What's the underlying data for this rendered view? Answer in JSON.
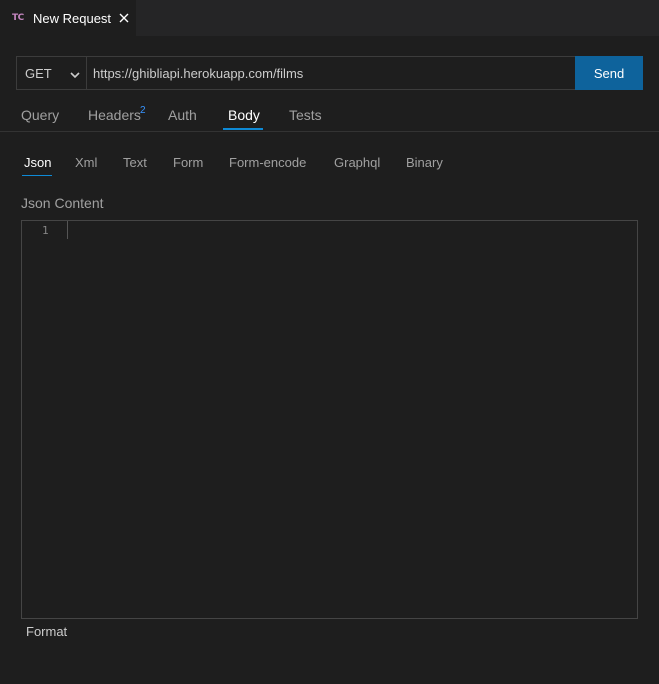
{
  "tab": {
    "logo": "TC",
    "title": "New Request"
  },
  "request": {
    "method": "GET",
    "url": "https://ghibliapi.herokuapp.com/films",
    "send_label": "Send"
  },
  "main_tabs": [
    {
      "label": "Query"
    },
    {
      "label": "Headers",
      "badge": "2"
    },
    {
      "label": "Auth"
    },
    {
      "label": "Body",
      "active": true
    },
    {
      "label": "Tests"
    }
  ],
  "body_tabs": [
    {
      "label": "Json",
      "active": true
    },
    {
      "label": "Xml"
    },
    {
      "label": "Text"
    },
    {
      "label": "Form"
    },
    {
      "label": "Form-encode"
    },
    {
      "label": "Graphql"
    },
    {
      "label": "Binary"
    }
  ],
  "content_label": "Json Content",
  "editor": {
    "line_number": "1"
  },
  "format_label": "Format",
  "colors": {
    "accent": "#0e639c",
    "underline": "#0e8ad6",
    "badge": "#3794ff"
  }
}
